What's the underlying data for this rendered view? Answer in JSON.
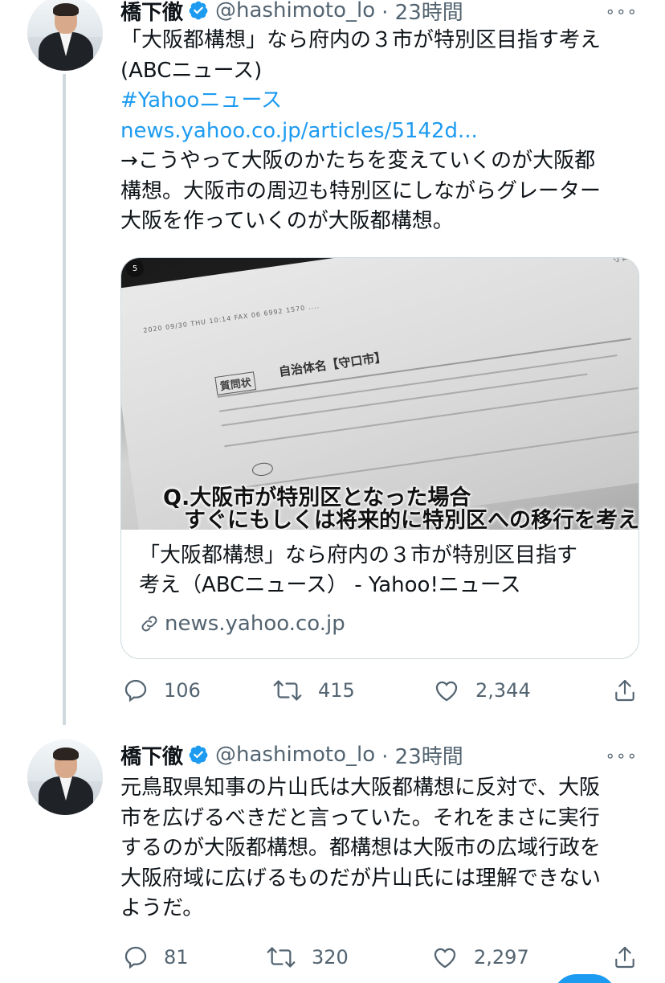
{
  "tweets": [
    {
      "author": {
        "name": "橋下徹",
        "handle": "@hashimoto_lo",
        "time": "· 23時間"
      },
      "more": "∘∘∘",
      "lines": [
        "「大阪都構想」なら府内の３市が特別区目指す考え",
        "(ABCニュース)"
      ],
      "hashtag": "#Yahooニュース",
      "url": "news.yahoo.co.jp/articles/5142d...",
      "comment_lines": [
        "→こうやって大阪のかたちを変えていくのが大阪都",
        "構想。大阪市の周辺も特別区にしながらグレーター",
        "大阪を作っていくのが大阪都構想。"
      ],
      "card": {
        "image_caption_lines": [
          "Q.大阪市が特別区となった場合",
          "すぐにもしくは将来的に特別区への移行を考えるか？"
        ],
        "document_heading": "自治体名【守口市】",
        "document_label": "質問状",
        "title_lines": [
          "「大阪都構想」なら府内の３市が特別区目指す",
          "考え（ABCニュース） - Yahoo!ニュース"
        ],
        "domain": "news.yahoo.co.jp"
      },
      "stats": {
        "replies": "106",
        "retweets": "415",
        "likes": "2,344"
      }
    },
    {
      "author": {
        "name": "橋下徹",
        "handle": "@hashimoto_lo",
        "time": "· 23時間"
      },
      "more": "∘∘∘",
      "lines": [
        "元鳥取県知事の片山氏は大阪都構想に反対で、大阪",
        "市を広げるべきだと言っていた。それをまさに実行",
        "するのが大阪都構想。都構想は大阪市の広域行政を",
        "大阪府域に広げるものだが片山氏には理解できない",
        "ようだ。"
      ],
      "stats": {
        "replies": "81",
        "retweets": "320",
        "likes": "2,297"
      }
    }
  ],
  "icons": {
    "verified": "verified-badge-icon",
    "reply": "reply-icon",
    "retweet": "retweet-icon",
    "like": "like-icon",
    "share": "share-icon",
    "link": "link-icon"
  },
  "colors": {
    "accent": "#1d9bf0",
    "secondary_text": "#536471",
    "border": "#cfd9de"
  }
}
